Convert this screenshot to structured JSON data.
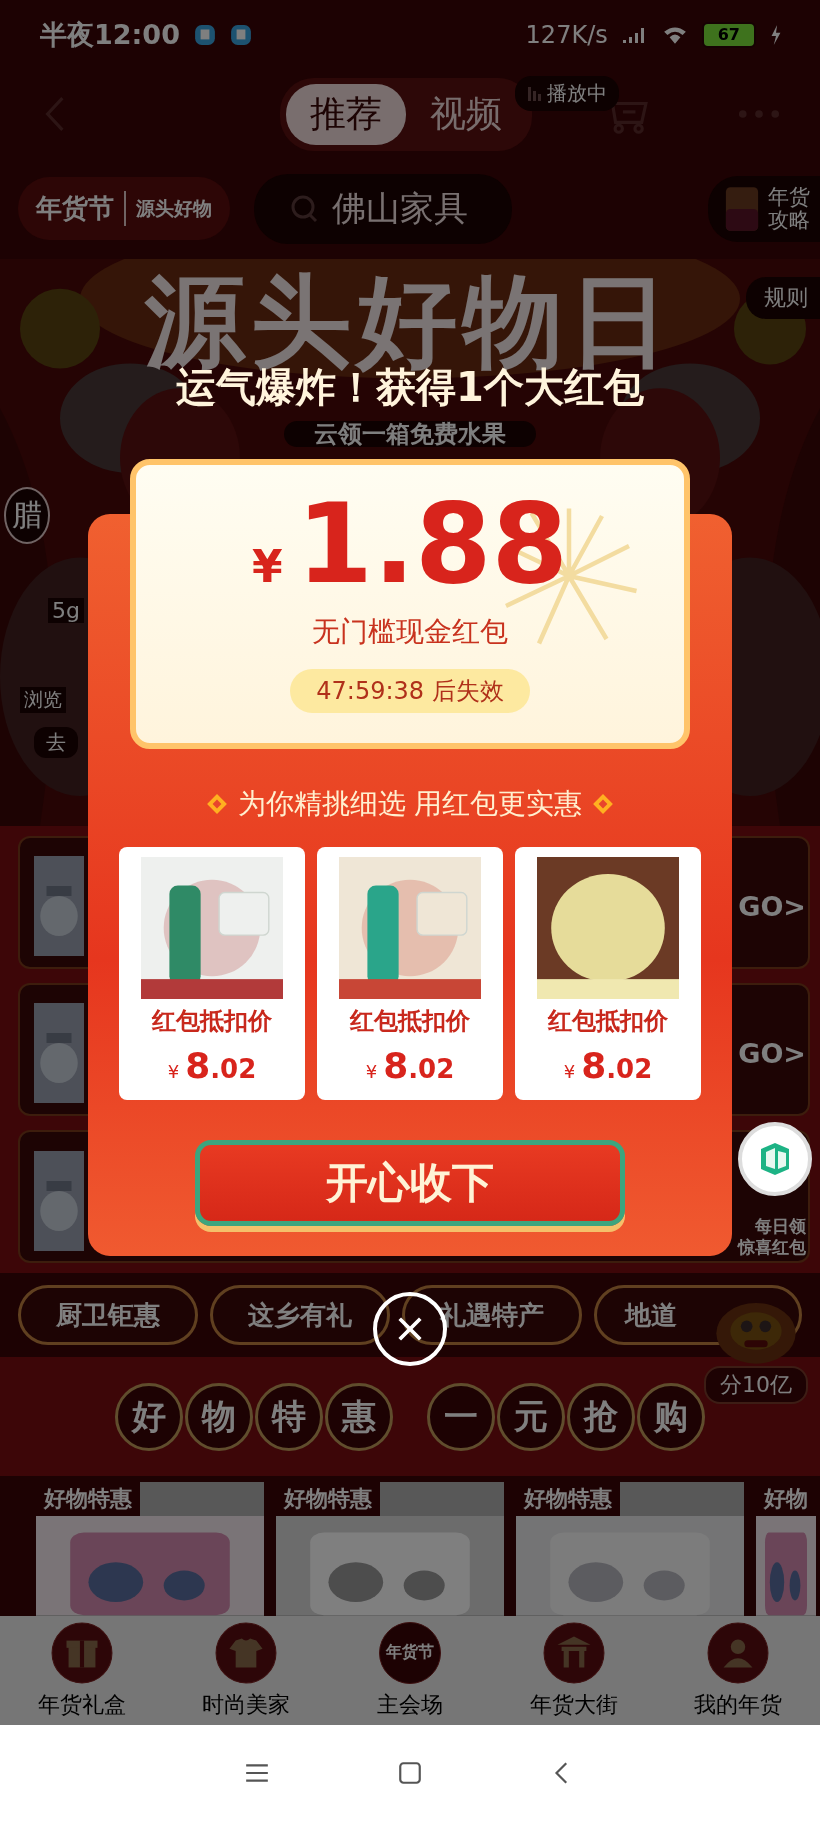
{
  "status_bar": {
    "time": "半夜12:00",
    "network_speed": "127K/s",
    "battery": "67"
  },
  "header": {
    "tabs": [
      {
        "label": "推荐",
        "selected": true
      },
      {
        "label": "视频",
        "selected": false
      }
    ],
    "playing_badge": "播放中"
  },
  "top_row": {
    "logo": "年货节",
    "logo_sub": "源头好物",
    "search": {
      "placeholder": "佛山家具"
    },
    "guide": "年货攻略"
  },
  "banner": {
    "title": "源头好物日",
    "rules": "规则",
    "subtitle": "云领一箱免费水果",
    "side_left": "腊",
    "weight_tag": "5g",
    "browse_tag": "浏览",
    "go_tag": "去"
  },
  "promo_rows": [
    {
      "kind": "go",
      "go": "GO>"
    },
    {
      "kind": "go",
      "go": "GO>"
    },
    {
      "kind": "gift",
      "lines": [
        "每日领",
        "惊喜红包"
      ]
    }
  ],
  "categories": [
    "厨卫钜惠",
    "这乡有礼",
    "礼遇特产",
    "地道"
  ],
  "lion_badge": "分10亿",
  "section_title": {
    "left": "好物特惠",
    "right": "一元抢购"
  },
  "products": [
    {
      "tag": "好物特惠"
    },
    {
      "tag": "好物特惠"
    },
    {
      "tag": "好物特惠"
    },
    {
      "tag": "好物"
    }
  ],
  "bottom_tabs": [
    {
      "kind": "gift",
      "label": "年货礼盒"
    },
    {
      "kind": "shirt",
      "label": "时尚美家"
    },
    {
      "kind": "logo",
      "label": "主会场",
      "icon_text": "年货节"
    },
    {
      "kind": "gate",
      "label": "年货大街"
    },
    {
      "kind": "person",
      "label": "我的年货"
    }
  ],
  "popup": {
    "headline": "运气爆炸！获得1个大红包",
    "currency": "¥",
    "amount": "1.88",
    "label": "无门槛现金红包",
    "expiry": "47:59:38 后失效",
    "recommend": "为你精挑细选 用红包更实惠",
    "items": [
      {
        "label": "红包抵扣价",
        "currency": "¥",
        "price": "8",
        "price_fraction": ".02"
      },
      {
        "label": "红包抵扣价",
        "currency": "¥",
        "price": "8",
        "price_fraction": ".02"
      },
      {
        "label": "红包抵扣价",
        "currency": "¥",
        "price": "8",
        "price_fraction": ".02"
      }
    ],
    "accept": "开心收下"
  }
}
